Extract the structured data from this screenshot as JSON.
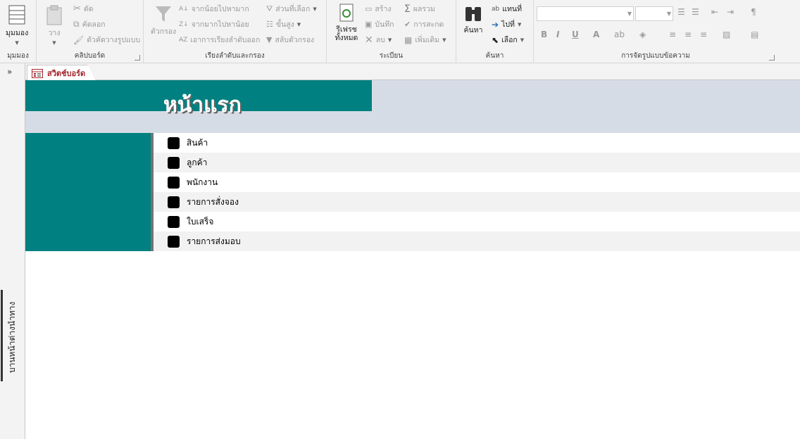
{
  "ribbon": {
    "views": {
      "label": "มุมมอง",
      "group": "มุมมอง"
    },
    "clipboard": {
      "group": "คลิปบอร์ด",
      "paste": "วาง",
      "cut": "ตัด",
      "copy": "คัดลอก",
      "format_painter": "ตัวคัดวางรูปแบบ"
    },
    "sort_filter": {
      "group": "เรียงลำดับและกรอง",
      "filter": "ตัวกรอง",
      "ascending": "จากน้อยไปหามาก",
      "descending": "จากมากไปหาน้อย",
      "remove_sort": "เอาการเรียงลำดับออก",
      "selection": "ส่วนที่เลือก",
      "advanced": "ขั้นสูง",
      "toggle_filter": "สลับตัวกรอง"
    },
    "records": {
      "group": "ระเบียน",
      "refresh": "รีเฟรชทั้งหมด",
      "new": "สร้าง",
      "save": "บันทึก",
      "delete": "ลบ",
      "totals": "ผลรวม",
      "spelling": "การสะกด",
      "more": "เพิ่มเติม"
    },
    "find": {
      "group": "ค้นหา",
      "find": "ค้นหา",
      "replace": "แทนที่",
      "goto": "ไปที่",
      "select": "เลือก"
    },
    "text_format": {
      "group": "การจัดรูปแบบข้อความ",
      "bold": "B",
      "italic": "I",
      "underline": "U"
    }
  },
  "nav_pane": {
    "label": "บานหน้าต่างนำทาง",
    "toggle": "»"
  },
  "tab": {
    "label": "สวิตช์บอร์ด"
  },
  "form": {
    "title": "หน้าแรก",
    "items": [
      "สินค้า",
      "ลูกค้า",
      "พนักงาน",
      "รายการสั่งจอง",
      "ใบเสร็จ",
      "รายการส่งมอบ"
    ]
  },
  "colors": {
    "teal": "#008080",
    "band": "#d6dce5",
    "tab_text": "#a4262c"
  }
}
